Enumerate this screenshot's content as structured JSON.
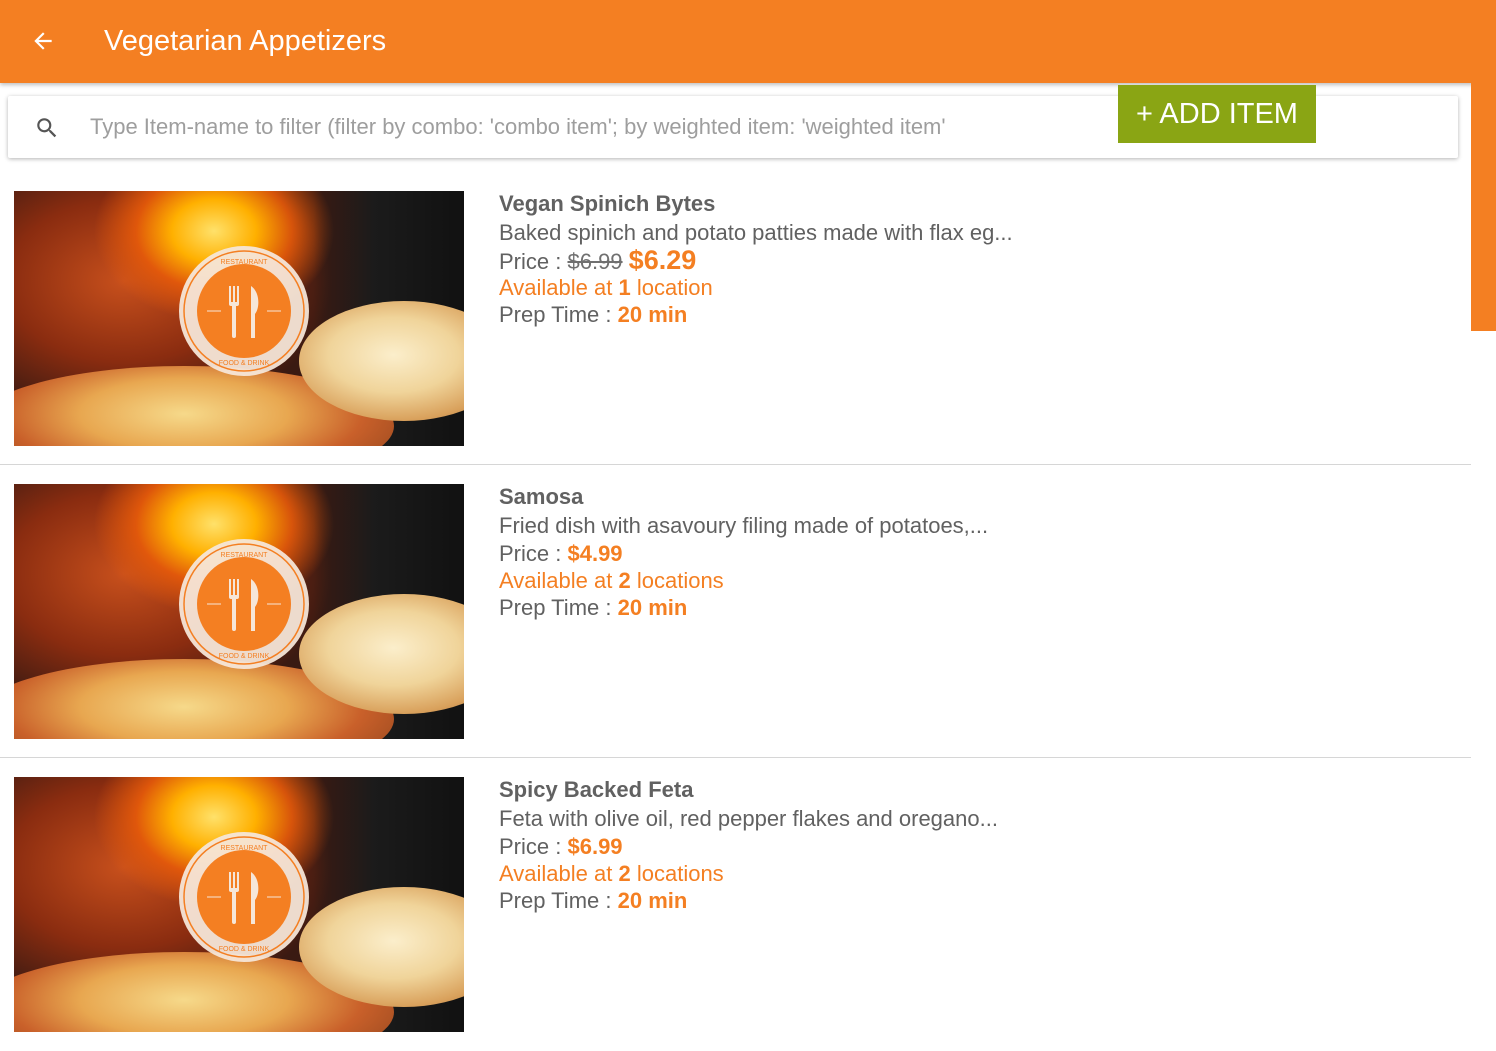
{
  "appbar": {
    "title": "Vegetarian Appetizers",
    "back_icon": "arrow-back-icon",
    "color": "#f47f22"
  },
  "search": {
    "placeholder": "Type Item-name to filter (filter by combo: 'combo item'; by weighted item: 'weighted item'",
    "value": "",
    "icon": "search-icon"
  },
  "add_button": {
    "label": "+ ADD ITEM",
    "color": "#8aa514"
  },
  "labels": {
    "price": "Price :",
    "available_prefix": "Available at",
    "prep": "Prep Time :"
  },
  "items": [
    {
      "name": "Vegan Spinich Bytes",
      "description": "Baked spinich and potato patties made with flax eg...",
      "old_price": "$6.99",
      "price": "$6.29",
      "locations_count": "1",
      "locations_word": "location",
      "prep_time": "20 min"
    },
    {
      "name": "Samosa",
      "description": "Fried dish with asavoury filing made of potatoes,...",
      "old_price": "",
      "price": "$4.99",
      "locations_count": "2",
      "locations_word": "locations",
      "prep_time": "20 min"
    },
    {
      "name": "Spicy Backed Feta",
      "description": "Feta with olive oil, red pepper flakes and oregano...",
      "old_price": "",
      "price": "$6.99",
      "locations_count": "2",
      "locations_word": "locations",
      "prep_time": "20 min"
    }
  ],
  "thumbnail": {
    "logo_text_top": "RESTAURANT",
    "logo_text_bottom": "FOOD & DRINK",
    "logo_icon": "fork-knife-icon"
  }
}
